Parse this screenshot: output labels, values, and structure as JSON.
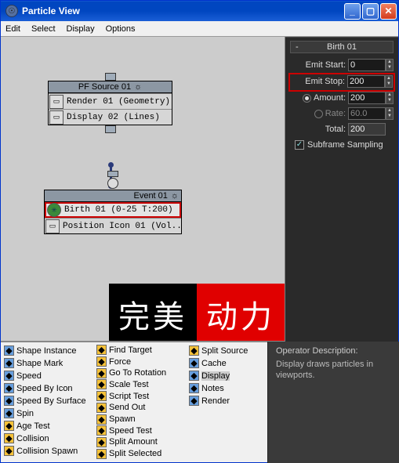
{
  "titlebar": {
    "title": "Particle View"
  },
  "menu": {
    "items": [
      "Edit",
      "Select",
      "Display",
      "Options"
    ]
  },
  "graph": {
    "source": {
      "header": "PF Source 01",
      "rows": [
        {
          "label": "Render 01 (Geometry)"
        },
        {
          "label": "Display 02 (Lines)"
        }
      ]
    },
    "event": {
      "header": "Event 01",
      "rows": [
        {
          "label": "Birth 01 (0-25 T:200)",
          "highlighted": true
        },
        {
          "label": "Position Icon 01 (Vol..."
        }
      ]
    }
  },
  "panel": {
    "rollup_title": "Birth 01",
    "emit_start": {
      "label": "Emit Start:",
      "value": "0"
    },
    "emit_stop": {
      "label": "Emit Stop:",
      "value": "200"
    },
    "amount": {
      "label": "Amount:",
      "value": "200"
    },
    "rate": {
      "label": "Rate:",
      "value": "60.0"
    },
    "total": {
      "label": "Total:",
      "value": "200"
    },
    "subframe": {
      "label": "Subframe Sampling",
      "checked": true
    }
  },
  "watermark": {
    "left": "完美",
    "right": "动力"
  },
  "depot": {
    "col1": [
      "Shape Instance",
      "Shape Mark",
      "Speed",
      "Speed By Icon",
      "Speed By Surface",
      "Spin",
      "Age Test",
      "Collision",
      "Collision Spawn"
    ],
    "col1_colors": [
      "blue",
      "blue",
      "blue",
      "blue",
      "blue",
      "blue",
      "yel",
      "yel",
      "yel"
    ],
    "col2": [
      "Find Target",
      "Force",
      "Go To Rotation",
      "Scale Test",
      "Script Test",
      "Send Out",
      "Spawn",
      "Speed Test",
      "Split Amount",
      "Split Selected"
    ],
    "col3": [
      "Split Source",
      "Cache",
      "Display",
      "Notes",
      "Render"
    ],
    "col3_colors": [
      "yel",
      "blue",
      "blue",
      "blue",
      "blue"
    ],
    "selected": "Display"
  },
  "description": {
    "heading": "Operator Description:",
    "body": "Display draws particles in viewports."
  }
}
